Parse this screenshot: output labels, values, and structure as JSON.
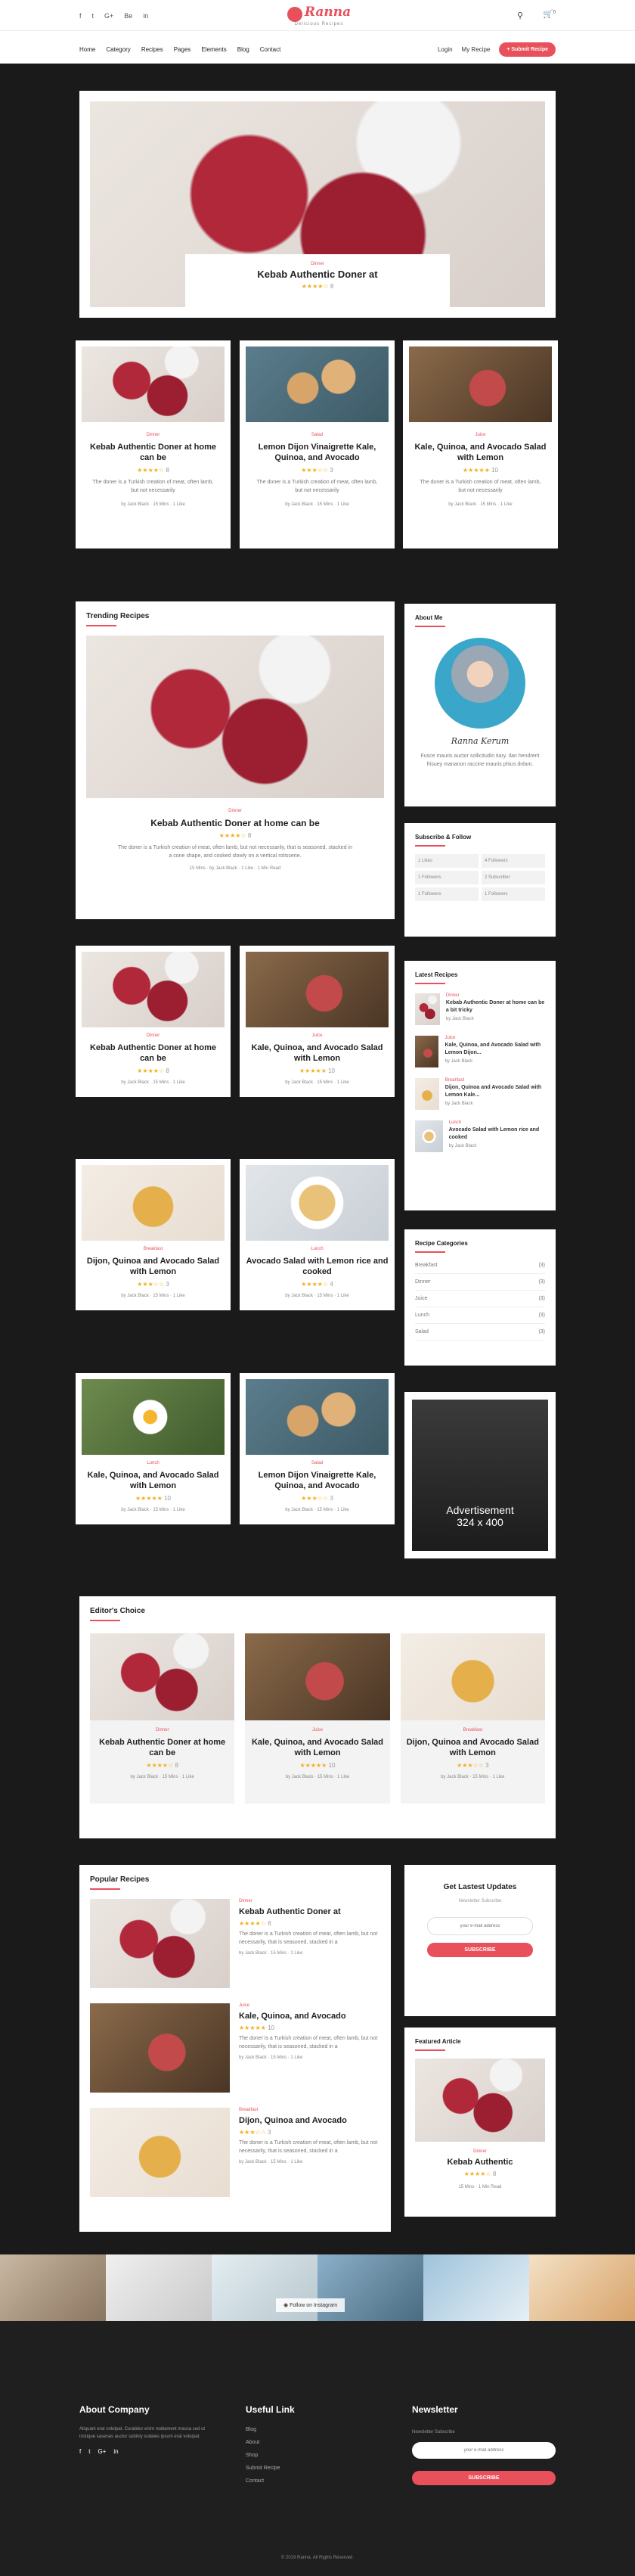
{
  "header": {
    "social": [
      "f",
      "t",
      "G+",
      "Be",
      "in"
    ],
    "logo_title": "Ranna",
    "logo_sub": "Delicious Recipes",
    "menu": [
      "Home",
      "Category",
      "Recipes",
      "Pages",
      "Elements",
      "Blog",
      "Contact"
    ],
    "login": "Login",
    "my_recipe": "My Recipe",
    "submit": "+ Submit Recipe",
    "cart_count": "0"
  },
  "hero": {
    "category": "Dinner",
    "title": "Kebab Authentic Doner at",
    "stars": "★★★★☆",
    "comments": "8"
  },
  "grid1": [
    {
      "category": "Dinner",
      "title": "Kebab Authentic Doner at home can be",
      "stars": "★★★★☆",
      "count": "8",
      "desc": "The doner is a Turkish creation of meat, often lamb, but not necessarily",
      "author": "by Jack Black",
      "time": "15 Mins",
      "likes": "1 Like"
    },
    {
      "category": "Salad",
      "title": "Lemon Dijon Vinaigrette Kale, Quinoa, and Avocado",
      "stars": "★★★☆☆",
      "count": "3",
      "desc": "The doner is a Turkish creation of meat, often lamb, but not necessarily",
      "author": "by Jack Black",
      "time": "15 Mins",
      "likes": "1 Like"
    },
    {
      "category": "Juice",
      "title": "Kale, Quinoa, and Avocado Salad with Lemon",
      "stars": "★★★★★",
      "count": "10",
      "desc": "The doner is a Turkish creation of meat, often lamb, but not necessarily",
      "author": "by Jack Black",
      "time": "15 Mins",
      "likes": "1 Like"
    }
  ],
  "trending": {
    "heading": "Trending Recipes",
    "category": "Dinner",
    "title": "Kebab Authentic Doner at home can be",
    "stars": "★★★★☆",
    "count": "8",
    "desc": "The doner is a Turkish creation of meat, often lamb, but not necessarily, that is seasoned, stacked in a cone shape, and cooked slowly on a vertical rotisserie.",
    "time": "15 Mins",
    "author": "by Jack Black",
    "likes": "1 Like",
    "read": "1 Min Read"
  },
  "grid2": [
    {
      "category": "Dinner",
      "title": "Kebab Authentic Doner at home can be",
      "stars": "★★★★☆",
      "count": "8",
      "author": "by Jack Black",
      "time": "15 Mins",
      "likes": "1 Like"
    },
    {
      "category": "Juice",
      "title": "Kale, Quinoa, and Avocado Salad with Lemon",
      "stars": "★★★★★",
      "count": "10",
      "author": "by Jack Black",
      "time": "15 Mins",
      "likes": "1 Like"
    },
    {
      "category": "Breakfast",
      "title": "Dijon, Quinoa and Avocado Salad with Lemon",
      "stars": "★★★☆☆",
      "count": "3",
      "author": "by Jack Black",
      "time": "15 Mins",
      "likes": "1 Like"
    },
    {
      "category": "Lunch",
      "title": "Avocado Salad with Lemon rice and cooked",
      "stars": "★★★★☆",
      "count": "4",
      "author": "by Jack Black",
      "time": "15 Mins",
      "likes": "1 Like"
    },
    {
      "category": "Lunch",
      "title": "Kale, Quinoa, and Avocado Salad with Lemon",
      "stars": "★★★★★",
      "count": "10",
      "author": "by Jack Black",
      "time": "15 Mins",
      "likes": "1 Like"
    },
    {
      "category": "Salad",
      "title": "Lemon Dijon Vinaigrette Kale, Quinoa, and Avocado",
      "stars": "★★★☆☆",
      "count": "3",
      "author": "by Jack Black",
      "time": "15 Mins",
      "likes": "1 Like"
    }
  ],
  "about": {
    "heading": "About Me",
    "signature": "Ranna Kerum",
    "text": "Fusce mauris auctor sollicitudin tiary. Ilan hendrerit frisuey mananon raccine mauris phius dnlam."
  },
  "subscribe": {
    "heading": "Subscribe & Follow",
    "items": [
      "1 Likes",
      "4 Followers",
      "1 Followers",
      "2 Subscriber",
      "1 Followers",
      "1 Followers"
    ]
  },
  "latest": {
    "heading": "Latest Recipes",
    "items": [
      {
        "category": "Dinner",
        "title": "Kebab Authentic Doner at home can be a bit tricky",
        "author": "by Jack Black"
      },
      {
        "category": "Juice",
        "title": "Kale, Quinoa, and Avocado Salad with Lemon Dijon...",
        "author": "by Jack Black"
      },
      {
        "category": "Breakfast",
        "title": "Dijon, Quinoa and Avocado Salad with Lemon Kale...",
        "author": "by Jack Black"
      },
      {
        "category": "Lunch",
        "title": "Avocado Salad with Lemon rice and cooked",
        "author": "by Jack Black"
      }
    ]
  },
  "categories": {
    "heading": "Recipe Categories",
    "items": [
      {
        "name": "Breakfast",
        "count": "(3)"
      },
      {
        "name": "Dinner",
        "count": "(3)"
      },
      {
        "name": "Juice",
        "count": "(3)"
      },
      {
        "name": "Lunch",
        "count": "(3)"
      },
      {
        "name": "Salad",
        "count": "(3)"
      }
    ]
  },
  "ad": {
    "title": "Advertisement",
    "size": "324 x 400"
  },
  "editors": {
    "heading": "Editor's Choice",
    "items": [
      {
        "category": "Dinner",
        "title": "Kebab Authentic Doner at home can be",
        "stars": "★★★★☆",
        "count": "8",
        "author": "by Jack Black",
        "time": "15 Mins",
        "likes": "1 Like"
      },
      {
        "category": "Juice",
        "title": "Kale, Quinoa, and Avocado Salad with Lemon",
        "stars": "★★★★★",
        "count": "10",
        "author": "by Jack Black",
        "time": "15 Mins",
        "likes": "1 Like"
      },
      {
        "category": "Breakfast",
        "title": "Dijon, Quinoa and Avocado Salad with Lemon",
        "stars": "★★★☆☆",
        "count": "3",
        "author": "by Jack Black",
        "time": "15 Mins",
        "likes": "1 Like"
      }
    ]
  },
  "popular": {
    "heading": "Popular Recipes",
    "items": [
      {
        "category": "Dinner",
        "title": "Kebab Authentic Doner at",
        "stars": "★★★★☆",
        "count": "8",
        "desc": "The doner is a Turkish creation of meat, often lamb, but not necessarily, that is seasoned, stacked in a",
        "author": "by Jack Black",
        "time": "15 Mins",
        "likes": "1 Like"
      },
      {
        "category": "Juice",
        "title": "Kale, Quinoa, and Avocado",
        "stars": "★★★★★",
        "count": "10",
        "desc": "The doner is a Turkish creation of meat, often lamb, but not necessarily, that is seasoned, stacked in a",
        "author": "by Jack Black",
        "time": "15 Mins",
        "likes": "1 Like"
      },
      {
        "category": "Breakfast",
        "title": "Dijon, Quinoa and Avocado",
        "stars": "★★★☆☆",
        "count": "3",
        "desc": "The doner is a Turkish creation of meat, often lamb, but not necessarily, that is seasoned, stacked in a",
        "author": "by Jack Black",
        "time": "15 Mins",
        "likes": "1 Like"
      }
    ]
  },
  "newsletter": {
    "heading": "Get Lastest Updates",
    "sub": "Newsletter Subscribe",
    "placeholder": "your e-mail address",
    "button": "SUBSCRIBE"
  },
  "featured": {
    "heading": "Featured Article",
    "category": "Dinner",
    "title": "Kebab Authentic",
    "stars": "★★★★☆",
    "count": "8",
    "time": "15 Mins",
    "read": "1 Min Read"
  },
  "instagram": {
    "label": "Follow on Instagram"
  },
  "footer": {
    "about_h": "About Company",
    "about_text": "Aliquam erat volutpat. Curabitur enim maltament massa sed ut tristique sasenas auctor sobinly sodales ipsum erat volutpat.",
    "social": [
      "f",
      "t",
      "G+",
      "in"
    ],
    "links_h": "Useful Link",
    "links": [
      "Blog",
      "About",
      "Shop",
      "Submit Recipe",
      "Contact"
    ],
    "news_h": "Newsletter",
    "news_sub": "Newsletter Subscribe",
    "news_placeholder": "your e-mail address",
    "news_button": "SUBSCRIBE",
    "copyright": "© 2019 Ranna. All Rights Reserved."
  }
}
